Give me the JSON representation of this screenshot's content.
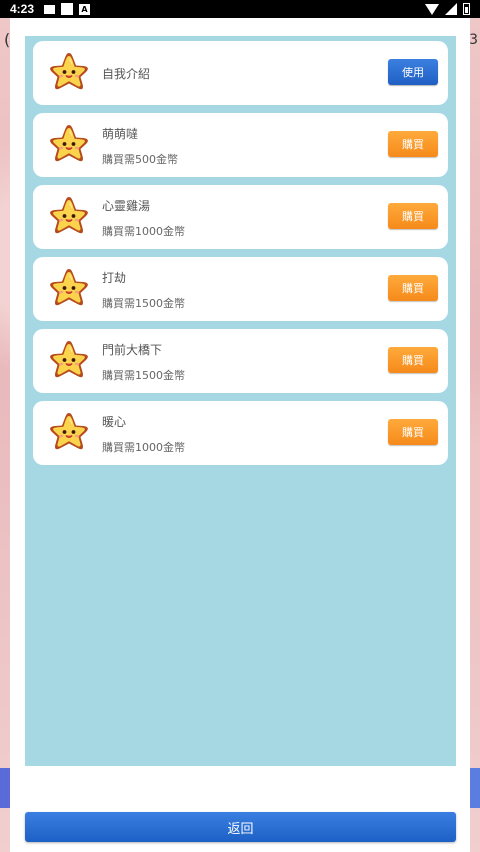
{
  "status_bar": {
    "time": "4:23",
    "left_icons": [
      "image-icon",
      "square-icon",
      "a-icon"
    ],
    "right_icons": [
      "wifi-icon",
      "signal-icon",
      "battery-icon"
    ]
  },
  "background": {
    "left_glyph": "(",
    "right_glyph": "3"
  },
  "items": [
    {
      "title": "自我介紹",
      "price": "",
      "button_label": "使用",
      "button_type": "use"
    },
    {
      "title": "萌萌噠",
      "price": "購買需500金幣",
      "button_label": "購買",
      "button_type": "buy"
    },
    {
      "title": "心靈雞湯",
      "price": "購買需1000金幣",
      "button_label": "購買",
      "button_type": "buy"
    },
    {
      "title": "打劫",
      "price": "購買需1500金幣",
      "button_label": "購買",
      "button_type": "buy"
    },
    {
      "title": "門前大橋下",
      "price": "購買需1500金幣",
      "button_label": "購買",
      "button_type": "buy"
    },
    {
      "title": "暖心",
      "price": "購買需1000金幣",
      "button_label": "購買",
      "button_type": "buy"
    }
  ],
  "back_button_label": "返回",
  "colors": {
    "list_panel_bg": "#a6d8e4",
    "use_button": "#2a6fd6",
    "buy_button": "#f7921f",
    "back_button": "#2a6fd6"
  }
}
